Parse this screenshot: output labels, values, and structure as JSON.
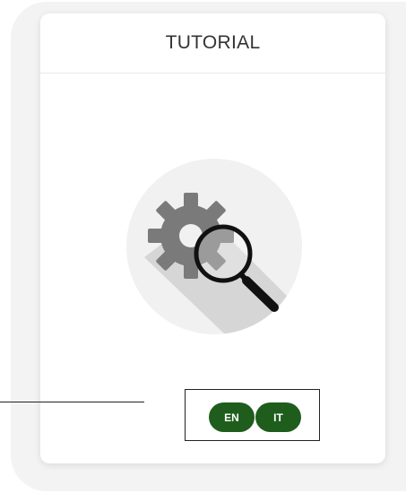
{
  "card": {
    "title": "TUTORIAL"
  },
  "illustration": {
    "icon": "settings-search-icon"
  },
  "language_selector": {
    "options": [
      {
        "label": "EN"
      },
      {
        "label": "IT"
      }
    ]
  },
  "colors": {
    "button_green": "#1e5d1c",
    "panel_bg": "#f3f3f4",
    "illustration_circle": "#f1f1f1",
    "gear_gray": "#7a7a7a"
  }
}
